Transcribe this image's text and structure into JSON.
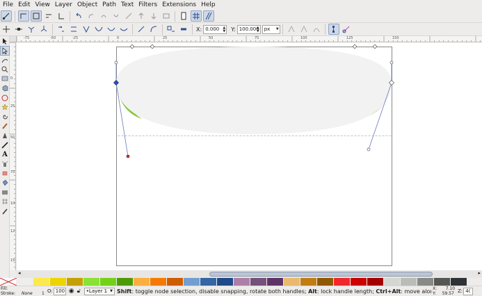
{
  "menubar": {
    "items": [
      "File",
      "Edit",
      "View",
      "Layer",
      "Object",
      "Path",
      "Text",
      "Filters",
      "Extensions",
      "Help"
    ]
  },
  "node_toolbar": {
    "x_label": "X:",
    "x_value": "0.000",
    "y_label": "Y:",
    "y_value": "100.000",
    "unit": "px"
  },
  "ruler": {
    "h_labels": [
      "-75",
      "-50",
      "-25",
      "0",
      "25",
      "50",
      "75",
      "100",
      "125",
      "150"
    ],
    "v_labels": [
      "0",
      "25",
      "50",
      "75",
      "100",
      "125",
      "150"
    ]
  },
  "palette": {
    "colors": [
      "#eeeeec",
      "#fce94f",
      "#edd400",
      "#c4a000",
      "#8ae234",
      "#73d216",
      "#4e9a06",
      "#fcaf3e",
      "#f57900",
      "#ce5c00",
      "#729fcf",
      "#3465a4",
      "#204a87",
      "#ad7fa8",
      "#75507b",
      "#5c3566",
      "#e9b96e",
      "#c17d11",
      "#8f5902",
      "#ef2929",
      "#cc0000",
      "#a40000",
      "#d3d7cf",
      "#babdb6",
      "#888a85",
      "#555753",
      "#2e3436"
    ]
  },
  "status": {
    "fill_label": "Fill:",
    "stroke_label": "Stroke:",
    "stroke_value": "None",
    "stroke_width": "1",
    "opacity_label": "O:",
    "opacity_value": "100",
    "layer_name": "•Layer 1",
    "message_key1": "Shift",
    "message_part1": ": toggle node selection, disable snapping, rotate both handles; ",
    "message_key2": "Alt",
    "message_part2": ": lock handle length; ",
    "message_key3": "Ctrl+Alt",
    "message_part3": ": move along ha...",
    "coord_x_label": "X:",
    "coord_x": "7.10",
    "coord_y_label": "Y:",
    "coord_y": "59.57",
    "zoom_label": "Z:",
    "zoom": "4("
  },
  "colors": {
    "ellipse_fill": "#f2f2f2",
    "side_fill": "#8cc63f",
    "selected_node": "#2b4fd6",
    "handle_end": "#cc3333"
  }
}
